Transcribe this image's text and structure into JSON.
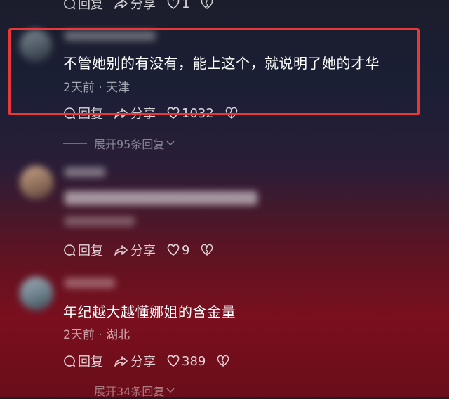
{
  "top_partial": {
    "reply_label": "回复",
    "share_label": "分享",
    "like_count": "1"
  },
  "comment1": {
    "text": "不管她别的有没有，能上这个，就说明了她的才华",
    "meta": "2天前 · 天津",
    "reply_label": "回复",
    "share_label": "分享",
    "like_count": "1032",
    "expand_label": "展开95条回复"
  },
  "comment2": {
    "reply_label": "回复",
    "share_label": "分享",
    "like_count": "9"
  },
  "comment3": {
    "text": "年纪越大越懂娜姐的含金量",
    "meta": "2天前 · 湖北",
    "reply_label": "回复",
    "share_label": "分享",
    "like_count": "389",
    "expand_label": "展开34条回复"
  },
  "colors": {
    "highlight_border": "#e8383a",
    "background_top": "#1c1d2c",
    "background_bottom": "#7a0f1e"
  }
}
